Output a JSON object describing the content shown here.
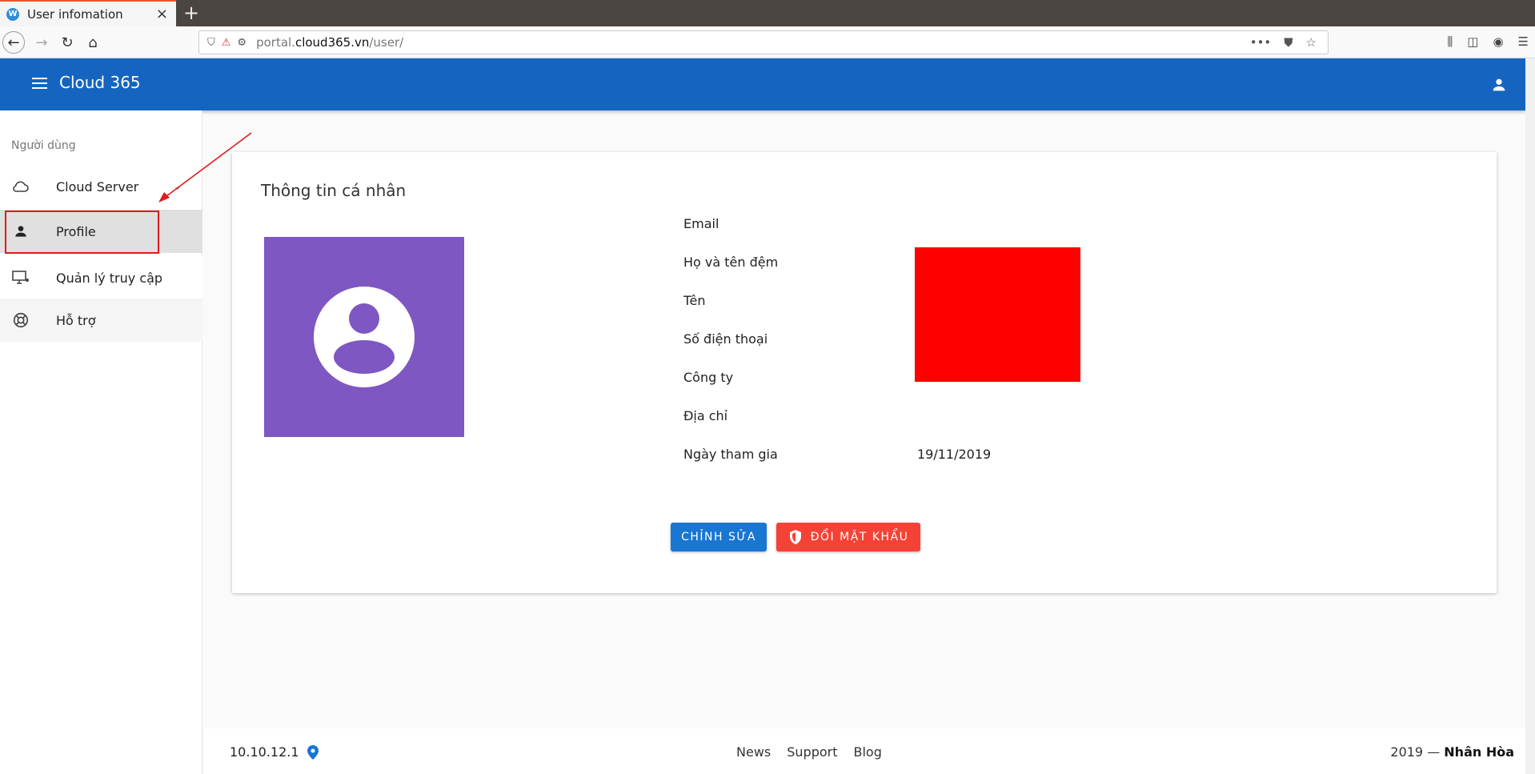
{
  "browser": {
    "tab_title": "User infomation",
    "favicon_letter": "W",
    "new_tab": "+",
    "close": "×",
    "url_host": "portal.cloud365.vn",
    "url_path": "/user/",
    "url_prefix": "portal."
  },
  "app": {
    "title": "Cloud 365"
  },
  "sidebar": {
    "heading": "Người dùng",
    "items": [
      {
        "label": "Cloud Server",
        "icon": "cloud-icon"
      },
      {
        "label": "Profile",
        "icon": "person-icon"
      },
      {
        "label": "Quản lý truy cập",
        "icon": "monitor-icon"
      },
      {
        "label": "Hỗ trợ",
        "icon": "lifebuoy-icon"
      }
    ]
  },
  "card": {
    "title": "Thông tin cá nhân",
    "fields": [
      {
        "label": "Email",
        "value": ""
      },
      {
        "label": "Họ và tên đệm",
        "value": ""
      },
      {
        "label": "Tên",
        "value": ""
      },
      {
        "label": "Số điện thoại",
        "value": ""
      },
      {
        "label": "Công ty",
        "value": ""
      },
      {
        "label": "Địa chỉ",
        "value": ""
      },
      {
        "label": "Ngày tham gia",
        "value": "19/11/2019"
      }
    ],
    "edit_button": "CHỈNH SỬA",
    "password_button": "ĐỔI MẬT KHẨU"
  },
  "footer": {
    "ip": "10.10.12.1",
    "links": [
      "News",
      "Support",
      "Blog"
    ],
    "copyright_prefix": "2019 — ",
    "copyright_owner": "Nhân Hòa"
  },
  "colors": {
    "appbar": "#1565c0",
    "avatar_bg": "#7e57c2",
    "edit_button": "#1976d2",
    "password_button": "#f44336",
    "redaction": "#ff0000"
  }
}
